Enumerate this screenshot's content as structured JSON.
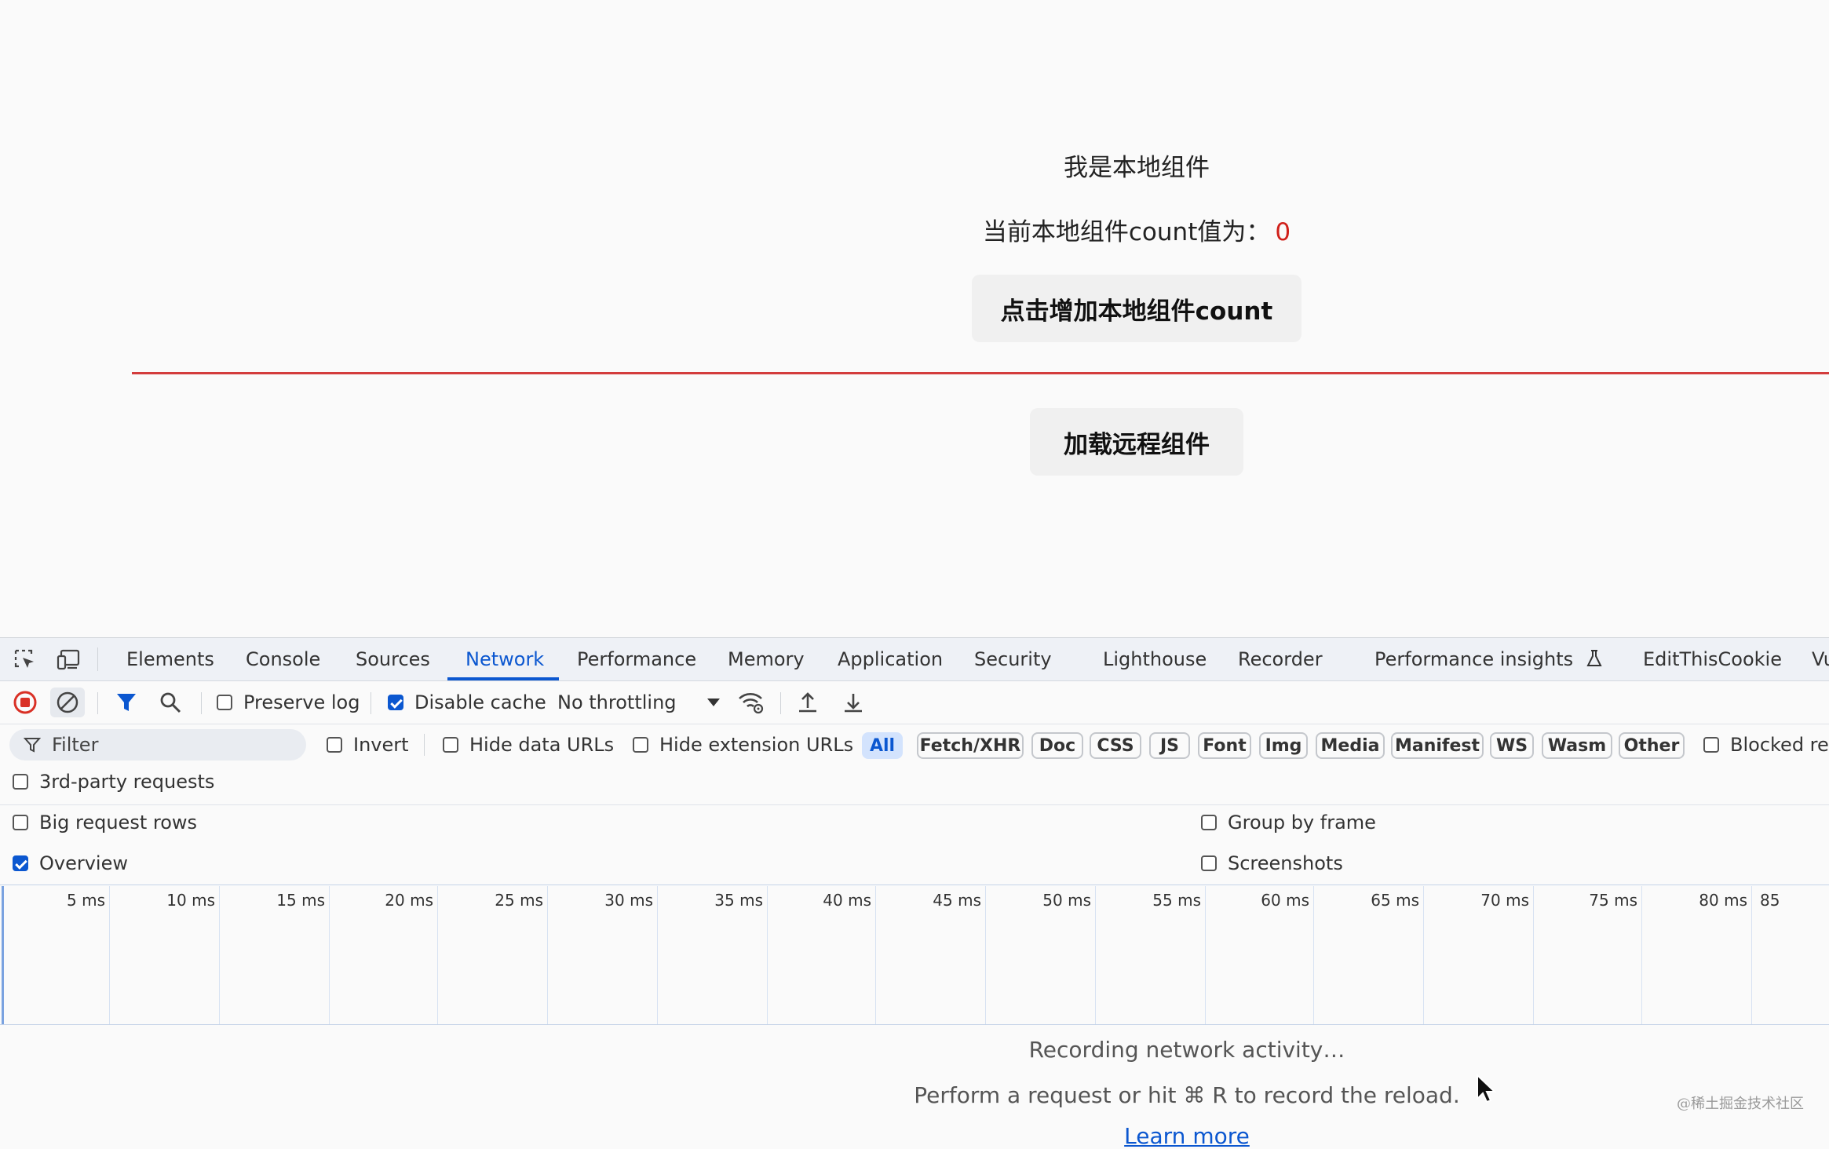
{
  "app": {
    "local_title": "我是本地组件",
    "count_label": "当前本地组件count值为：",
    "count_value": "0",
    "increment_button": "点击增加本地组件count",
    "load_remote_button": "加载远程组件"
  },
  "devtools": {
    "tabs": [
      "Elements",
      "Console",
      "Sources",
      "Network",
      "Performance",
      "Memory",
      "Application",
      "Security",
      "Lighthouse",
      "Recorder",
      "Performance insights",
      "EditThisCookie",
      "Vu"
    ],
    "active_tab": "Network",
    "toolbar": {
      "preserve_log": "Preserve log",
      "disable_cache": "Disable cache",
      "throttling": "No throttling"
    },
    "filter": {
      "placeholder": "Filter",
      "invert": "Invert",
      "hide_data_urls": "Hide data URLs",
      "hide_extension_urls": "Hide extension URLs",
      "types": [
        "All",
        "Fetch/XHR",
        "Doc",
        "CSS",
        "JS",
        "Font",
        "Img",
        "Media",
        "Manifest",
        "WS",
        "Wasm",
        "Other"
      ],
      "selected_type": "All",
      "blocked": "Blocked res"
    },
    "third_party": "3rd-party requests",
    "settings": {
      "big_request_rows": "Big request rows",
      "overview": "Overview",
      "group_by_frame": "Group by frame",
      "screenshots": "Screenshots"
    },
    "timeline_ticks": [
      "5 ms",
      "10 ms",
      "15 ms",
      "20 ms",
      "25 ms",
      "30 ms",
      "35 ms",
      "40 ms",
      "45 ms",
      "50 ms",
      "55 ms",
      "60 ms",
      "65 ms",
      "70 ms",
      "75 ms",
      "80 ms",
      "85"
    ],
    "empty_state": {
      "recording": "Recording network activity…",
      "hint": "Perform a request or hit ⌘ R to record the reload.",
      "learn_more": "Learn more"
    }
  },
  "watermark": "@稀土掘金技术社区"
}
